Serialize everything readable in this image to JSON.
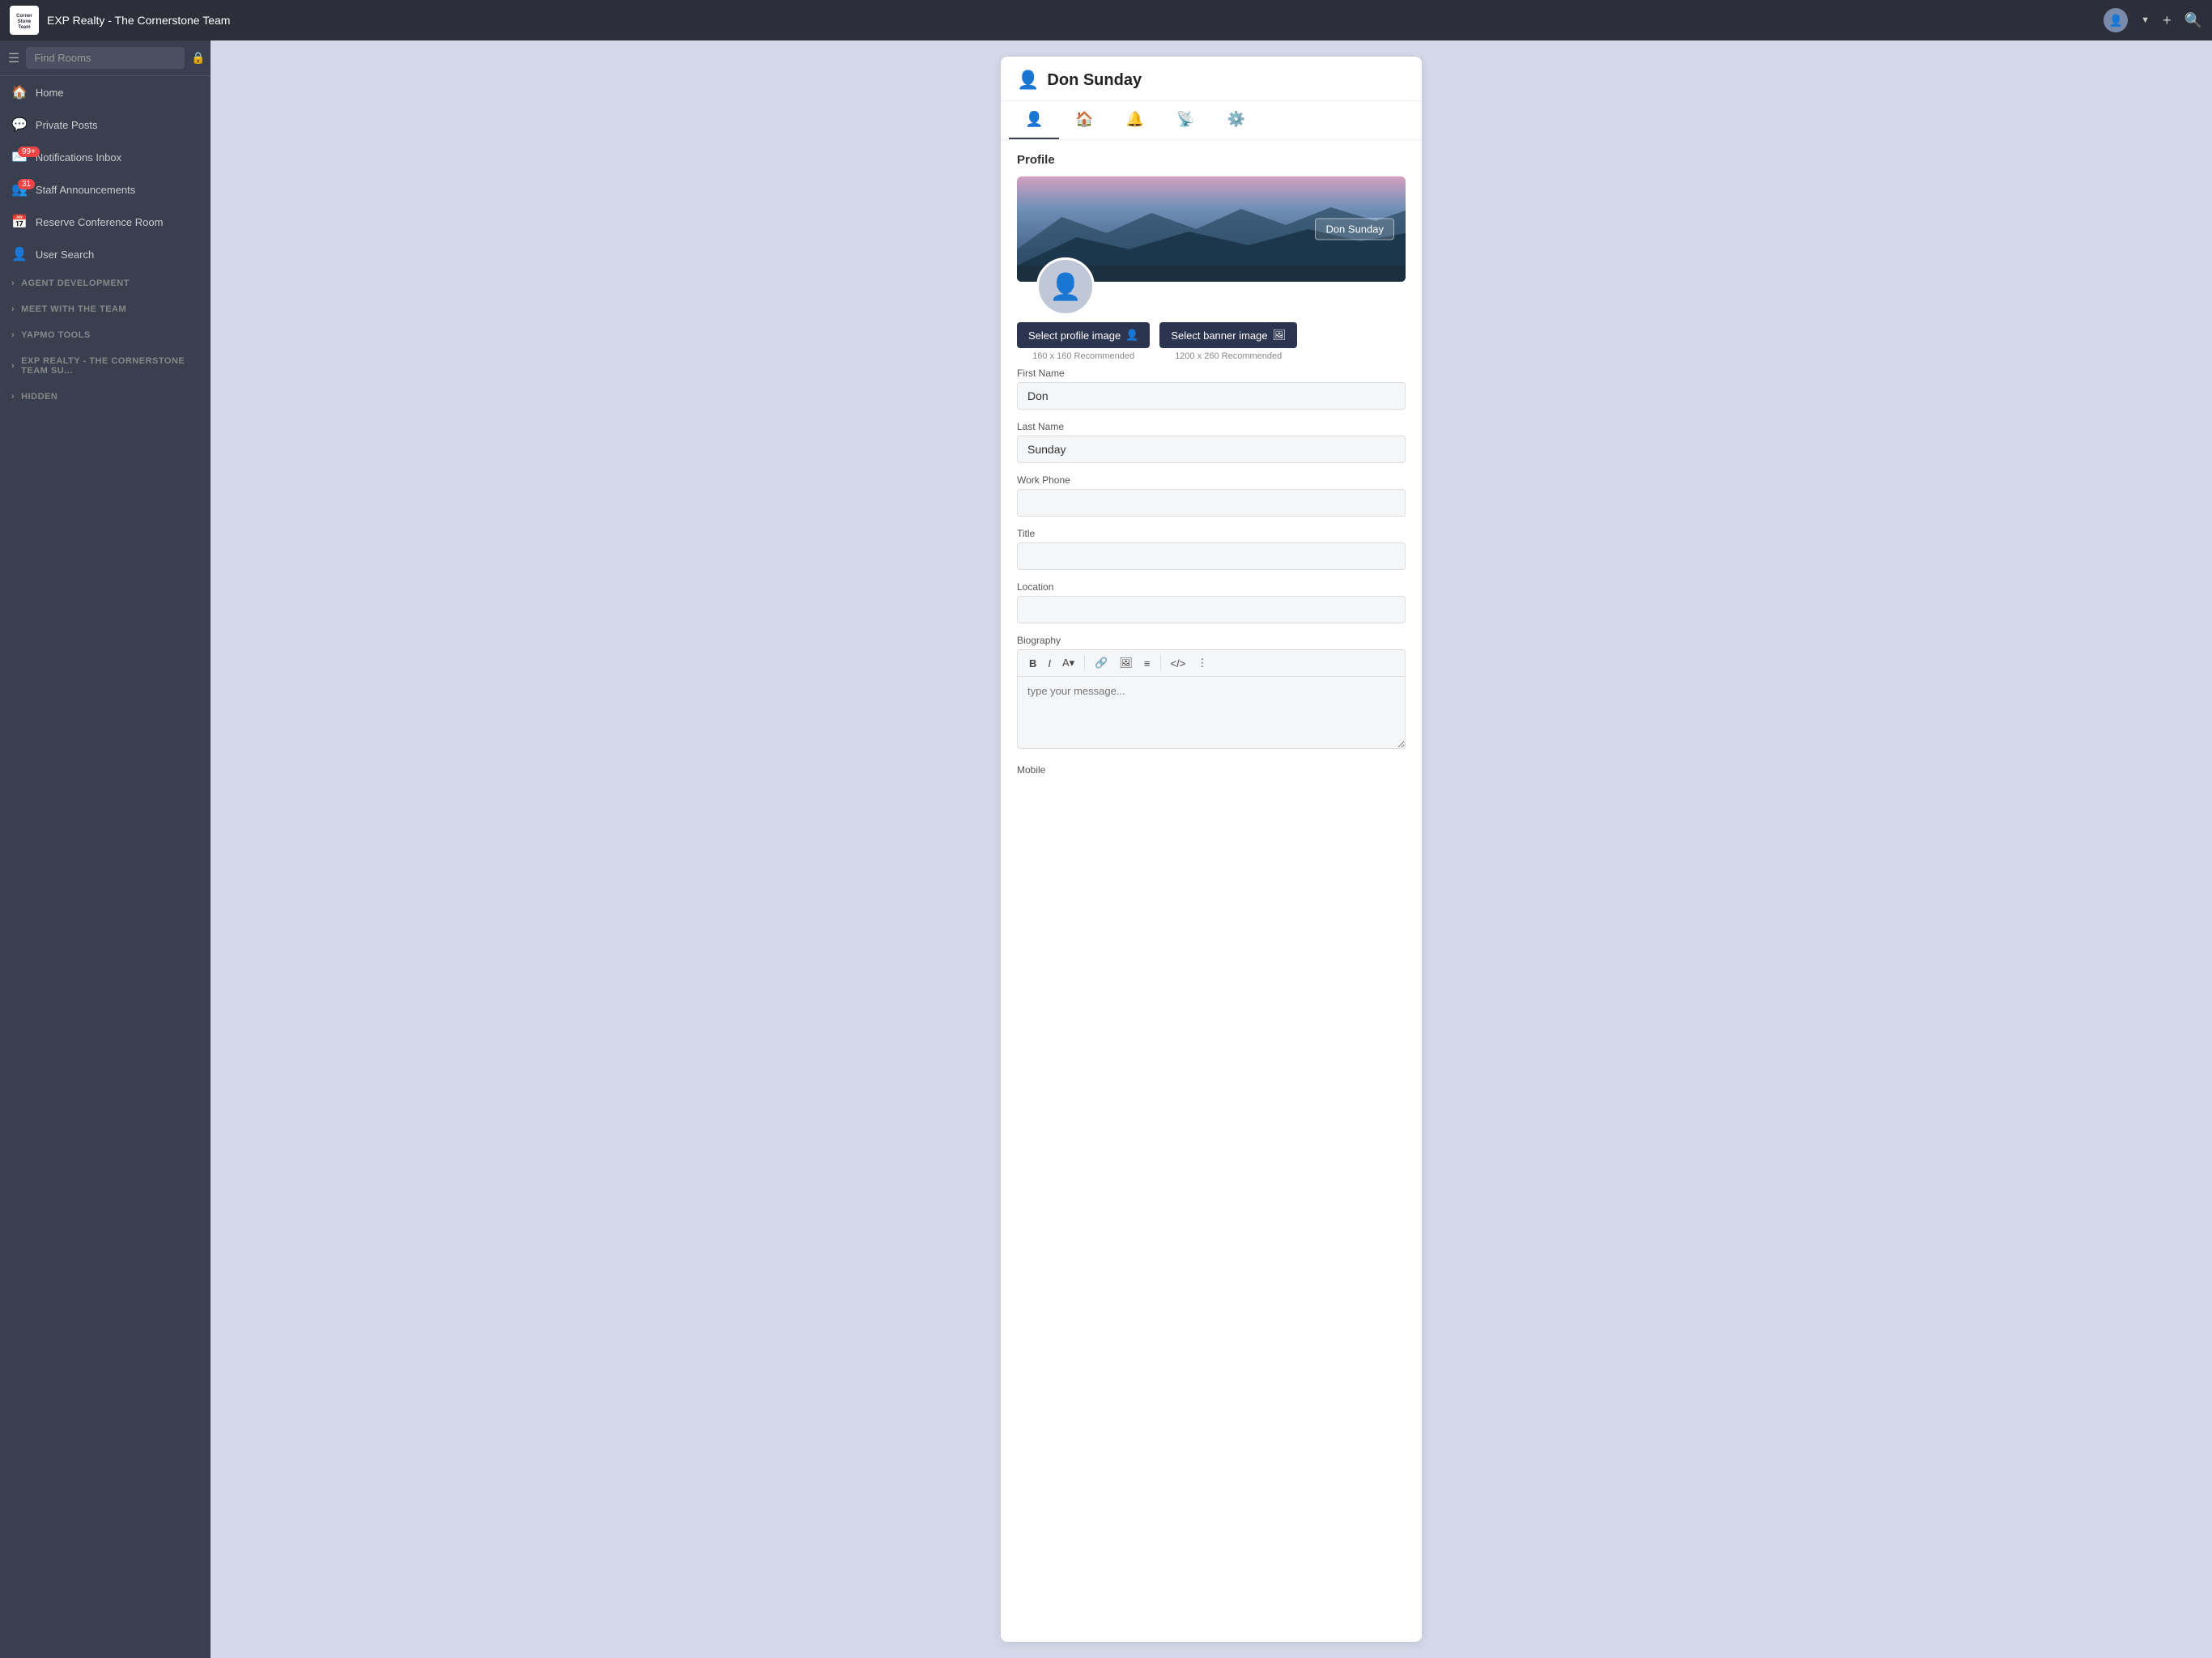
{
  "topbar": {
    "logo_text": "Corner\nStone\nTeam",
    "title": "EXP Realty - The Cornerstone Team"
  },
  "sidebar": {
    "search_placeholder": "Find Rooms",
    "items": [
      {
        "id": "home",
        "label": "Home",
        "icon": "🏠",
        "badge": null
      },
      {
        "id": "private-posts",
        "label": "Private Posts",
        "icon": "💬",
        "badge": null
      },
      {
        "id": "notifications",
        "label": "Notifications Inbox",
        "icon": "✉️",
        "badge": "99+"
      },
      {
        "id": "staff-announcements",
        "label": "Staff Announcements",
        "icon": "👥",
        "badge": "31"
      },
      {
        "id": "reserve-room",
        "label": "Reserve Conference Room",
        "icon": "📅",
        "badge": null
      },
      {
        "id": "user-search",
        "label": "User Search",
        "icon": "👤",
        "badge": null
      }
    ],
    "sections": [
      {
        "id": "agent-development",
        "label": "AGENT DEVELOPMENT"
      },
      {
        "id": "meet-team",
        "label": "MEET WITH THE TEAM"
      },
      {
        "id": "yapmo-tools",
        "label": "YAPMO TOOLS"
      },
      {
        "id": "exp-cornerstone",
        "label": "EXP Realty - The Cornerstone Team Su..."
      },
      {
        "id": "hidden",
        "label": "HIDDEN"
      }
    ]
  },
  "profile": {
    "user_name": "Don Sunday",
    "tab_active": "profile",
    "tabs": [
      {
        "id": "profile",
        "icon": "👤"
      },
      {
        "id": "home",
        "icon": "🏠"
      },
      {
        "id": "notifications",
        "icon": "🔔"
      },
      {
        "id": "feed",
        "icon": "📡"
      },
      {
        "id": "settings",
        "icon": "⚙️"
      }
    ],
    "section_title": "Profile",
    "name_badge": "Don Sunday",
    "select_profile_image": "Select profile image",
    "select_banner_image": "Select banner image",
    "profile_hint": "160 x 160 Recommended",
    "banner_hint": "1200 x 260 Recommended",
    "fields": {
      "first_name_label": "First Name",
      "first_name_value": "Don",
      "last_name_label": "Last Name",
      "last_name_value": "Sunday",
      "work_phone_label": "Work Phone",
      "work_phone_value": "",
      "title_label": "Title",
      "title_value": "",
      "location_label": "Location",
      "location_value": "",
      "biography_label": "Biography",
      "biography_placeholder": "type your message...",
      "mobile_label": "Mobile"
    },
    "bio_toolbar": {
      "bold": "B",
      "italic": "I",
      "font": "A▾",
      "link": "🔗",
      "image": "🖼",
      "list": "≡",
      "code": "</>",
      "more": "⋮"
    }
  }
}
